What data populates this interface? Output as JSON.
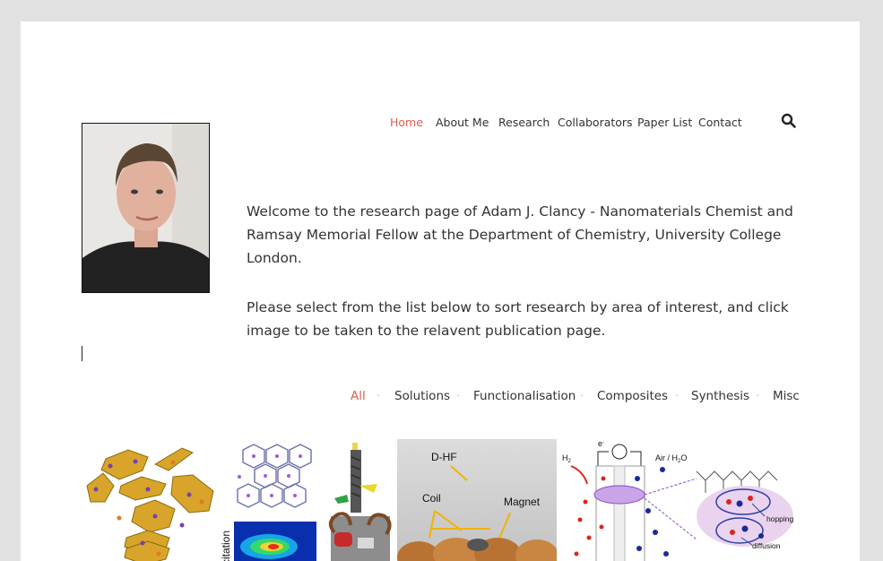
{
  "nav": {
    "items": [
      {
        "label": "Home",
        "active": true
      },
      {
        "label": "About Me",
        "active": false
      },
      {
        "label": "Research",
        "active": false
      },
      {
        "label": "Collaborators",
        "active": false
      },
      {
        "label": "Paper List",
        "active": false
      },
      {
        "label": "Contact",
        "active": false
      }
    ],
    "search_icon": "search-icon"
  },
  "intro": {
    "paragraph1": "Welcome to the research page of Adam J. Clancy - Nanomaterials Chemist and Ramsay Memorial Fellow at the Department of Chemistry, University College London.",
    "paragraph2": "Please select from the list below to sort research by area of interest, and click image to be taken to the relavent publication page."
  },
  "filters": {
    "items": [
      {
        "label": "All",
        "active": true
      },
      {
        "label": "Solutions",
        "active": false
      },
      {
        "label": "Functionalisation",
        "active": false
      },
      {
        "label": "Composites",
        "active": false
      },
      {
        "label": "Synthesis",
        "active": false
      },
      {
        "label": "Misc",
        "active": false
      }
    ]
  },
  "gallery": {
    "item2_axis": "citation",
    "item4_labels": {
      "dhf": "D-HF",
      "coil": "Coil",
      "magnet": "Magnet"
    },
    "item5_labels": {
      "h2": "H",
      "h2_sub": "2",
      "electron": "e",
      "electron_sup": "-",
      "air": "Air / H",
      "air_sub": "2",
      "air_o": "O",
      "hopping": "hopping",
      "diffusion": "diffusion"
    }
  },
  "colors": {
    "accent": "#e05d4b",
    "text": "#333333",
    "background": "#e2e1e1"
  }
}
